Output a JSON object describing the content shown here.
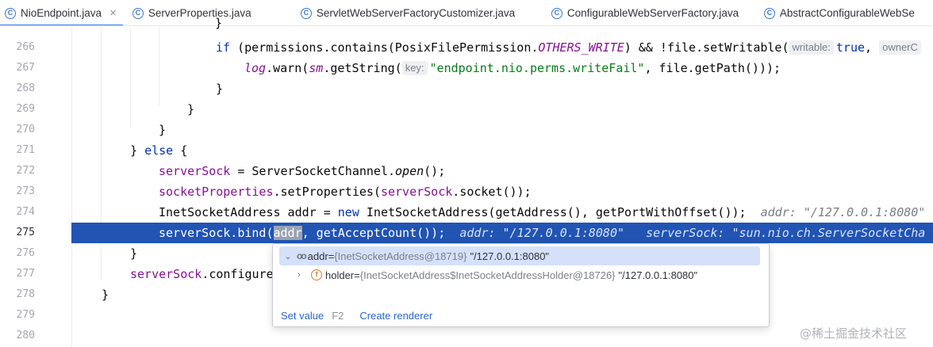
{
  "tabs": [
    {
      "name": "NioEndpoint.java",
      "active": true,
      "close": "×"
    },
    {
      "name": "ServerProperties.java",
      "active": false
    },
    {
      "name": "ServletWebServerFactoryCustomizer.java",
      "active": false
    },
    {
      "name": "ConfigurableWebServerFactory.java",
      "active": false
    },
    {
      "name": "AbstractConfigurableWebSe",
      "active": false
    }
  ],
  "tab_icon_letter": "C",
  "line_numbers": [
    "266",
    "267",
    "268",
    "269",
    "270",
    "271",
    "272",
    "273",
    "274",
    "275",
    "276",
    "277",
    "278",
    "279",
    "280"
  ],
  "current_line": "275",
  "code": {
    "l265_tail": "}",
    "l266": {
      "kw": "if",
      "a": " (permissions.contains(PosixFilePermission.",
      "cst": "OTHERS_WRITE",
      "b": ") && !file.setWritable(",
      "hint1": "writable:",
      "kw2": "true",
      "c": ",",
      "hint2": "ownerC"
    },
    "l267": {
      "fld1": "log",
      "a": ".warn(",
      "fld2": "sm",
      "b": ".getString(",
      "hint": "key:",
      "str": "\"endpoint.nio.perms.writeFail\"",
      "c": ", file.getPath()));"
    },
    "l268": "}",
    "l269": "}",
    "l270": "}",
    "l271": {
      "a": "} ",
      "kw": "else",
      "b": " {"
    },
    "l272": {
      "fld": "serverSock",
      "a": " = ServerSocketChannel.",
      "it": "open",
      "b": "();"
    },
    "l273": {
      "fld": "socketProperties",
      "a": ".setProperties(",
      "fld2": "serverSock",
      "b": ".socket());"
    },
    "l274": {
      "a": "InetSocketAddress addr = ",
      "kw": "new",
      "b": " InetSocketAddress(getAddress(), getPortWithOffset());",
      "inline": "addr: \"/127.0.0.1:8080\""
    },
    "l275": {
      "a": "serverSock.bind(",
      "sel": "addr",
      "b": ", getAcceptCount());",
      "inline1": "addr: \"/127.0.0.1:8080\"",
      "inline2": "serverSock: \"sun.nio.ch.ServerSocketCha"
    },
    "l276": "}",
    "l277": {
      "fld": "serverSock",
      "a": ".configure"
    },
    "l278": "}"
  },
  "popup": {
    "row1": {
      "expand": "⌄",
      "name": "addr",
      "eq": " = ",
      "type": "{InetSocketAddress@18719}",
      "value": "\"/127.0.0.1:8080\""
    },
    "row2": {
      "expand": "›",
      "field_letter": "f",
      "name": "holder",
      "eq": " = ",
      "type": "{InetSocketAddress$InetSocketAddressHolder@18726}",
      "value": "\"/127.0.0.1:8080\""
    },
    "set_value": "Set value",
    "set_value_key": "F2",
    "create_renderer": "Create renderer"
  },
  "watermark": "@稀土掘金技术社区",
  "colors": {
    "accent": "#3574f0",
    "highlight_line": "#2154b3",
    "keyword": "#0033b3",
    "field": "#871094",
    "string": "#067d17"
  }
}
